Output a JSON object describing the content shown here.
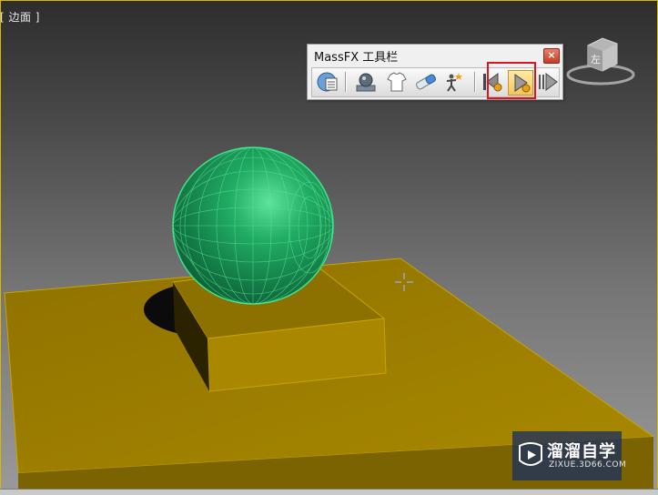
{
  "viewport": {
    "label": "[ 边面 ]",
    "colors": {
      "background_top": "#2d2d2d",
      "background_bottom": "#9a9a9a",
      "frame": "#d9b800",
      "sphere": "#1a9a5a",
      "box": "#a58400"
    }
  },
  "massfx_toolbar": {
    "title": "MassFX 工具栏",
    "close_icon": "close-icon",
    "buttons": [
      {
        "icon": "world-settings-icon"
      },
      {
        "icon": "rigid-body-icon"
      },
      {
        "icon": "mcloth-icon"
      },
      {
        "icon": "constraint-icon"
      },
      {
        "icon": "ragdoll-icon"
      },
      {
        "icon": "reset-simulation-icon"
      },
      {
        "icon": "play-simulation-icon"
      },
      {
        "icon": "step-simulation-icon"
      }
    ],
    "highlighted_button": "play-simulation-icon",
    "highlight_color": "#e0141e"
  },
  "viewcube": {
    "face_label": "左"
  },
  "watermark": {
    "title": "溜溜自学",
    "url": "ZIXUE.3D66.COM"
  }
}
